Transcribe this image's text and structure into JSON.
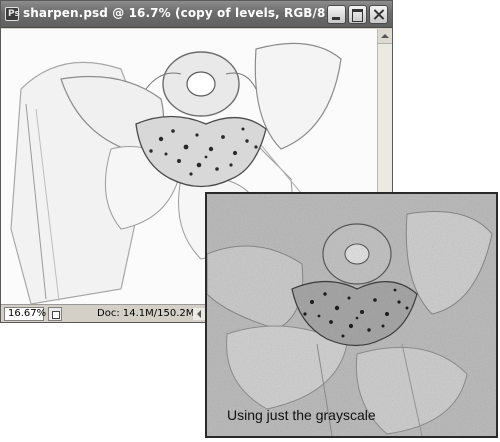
{
  "window": {
    "title_icon": "Ps",
    "title": "sharpen.psd @ 16.7% (copy of levels, RGB/8)",
    "buttons": {
      "minimize": "minimize-icon",
      "maximize": "maximize-icon",
      "close": "close-icon"
    }
  },
  "statusbar": {
    "zoom": "16.67%",
    "doc_info": "Doc: 14.1M/150.2M"
  },
  "overlay": {
    "caption": "Using just the grayscale"
  }
}
